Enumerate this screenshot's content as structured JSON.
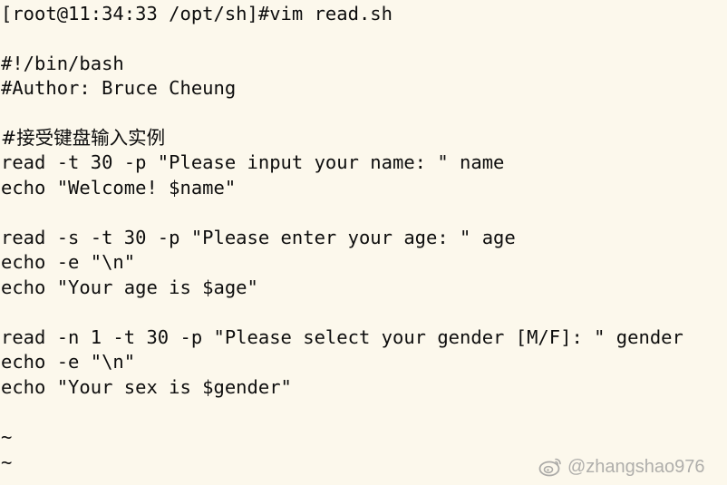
{
  "terminal": {
    "lines": [
      "[root@11:34:33 /opt/sh]#vim read.sh",
      "",
      "#!/bin/bash",
      "#Author: Bruce Cheung",
      "",
      "#接受键盘输入实例",
      "read -t 30 -p \"Please input your name: \" name",
      "echo \"Welcome! $name\"",
      "",
      "read -s -t 30 -p \"Please enter your age: \" age",
      "echo -e \"\\n\"",
      "echo \"Your age is $age\"",
      "",
      "read -n 1 -t 30 -p \"Please select your gender [M/F]: \" gender",
      "echo -e \"\\n\"",
      "echo \"Your sex is $gender\"",
      "",
      "~",
      "~"
    ]
  },
  "watermark": {
    "text": "@zhangshao976",
    "icon": "weibo-icon"
  },
  "colors": {
    "background": "#fcf8ec",
    "text": "#0d0d0d"
  }
}
